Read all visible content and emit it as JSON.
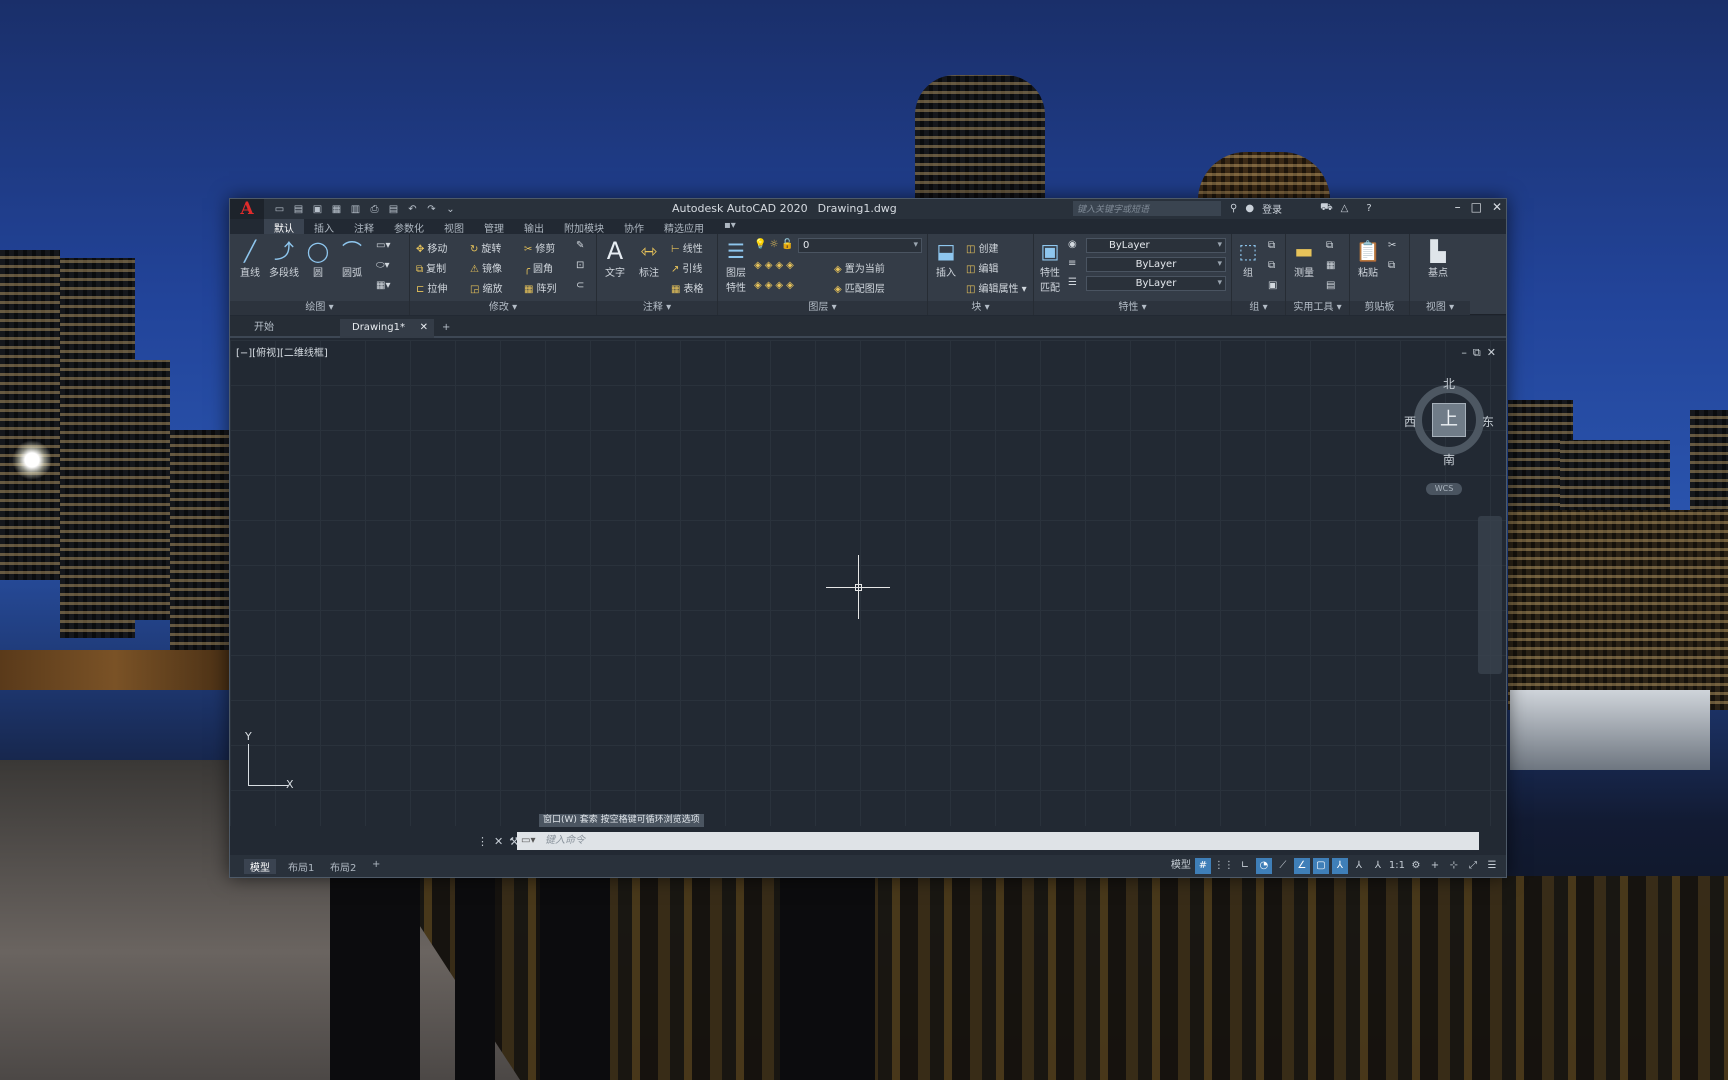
{
  "app": {
    "title": "Autodesk AutoCAD 2020",
    "filename": "Drawing1.dwg",
    "logo": "A",
    "search_placeholder": "键入关键字或短语",
    "login": "登录"
  },
  "ribbon_tabs": [
    "默认",
    "插入",
    "注释",
    "参数化",
    "视图",
    "管理",
    "输出",
    "附加模块",
    "协作",
    "精选应用"
  ],
  "panels": {
    "draw": {
      "title": "绘图 ▾",
      "line": "直线",
      "polyline": "多段线",
      "circle": "圆",
      "arc": "圆弧"
    },
    "modify": {
      "title": "修改 ▾",
      "move": "移动",
      "rotate": "旋转",
      "trim": "修剪",
      "copy": "复制",
      "mirror": "镜像",
      "fillet": "圆角",
      "stretch": "拉伸",
      "scale": "缩放",
      "array": "阵列"
    },
    "annotation": {
      "title": "注释 ▾",
      "text": "文字",
      "dimension": "标注",
      "linear": "线性",
      "leader": "引线",
      "table": "表格"
    },
    "layers": {
      "title": "图层 ▾",
      "layer_props": "图层\n特性",
      "layer_value": "0",
      "make_current": "置为当前",
      "match_layer": "匹配图层"
    },
    "block": {
      "title": "块 ▾",
      "insert": "插入",
      "create": "创建",
      "edit": "编辑",
      "edit_attr": "编辑属性"
    },
    "properties": {
      "title": "特性 ▾",
      "match": "特性\n匹配",
      "color": "ByLayer",
      "linetype": "ByLayer",
      "lineweight": "ByLayer"
    },
    "groups": {
      "title": "组 ▾",
      "group": "组"
    },
    "utilities": {
      "title": "实用工具 ▾",
      "measure": "测量"
    },
    "clipboard": {
      "title": "剪贴板",
      "paste": "粘贴"
    },
    "view": {
      "title": "视图 ▾",
      "base": "基点"
    }
  },
  "doc_tabs": {
    "start": "开始",
    "drawing": "Drawing1*",
    "close": "✕",
    "add": "+"
  },
  "viewport": {
    "label": "[−][俯视][二维线框]"
  },
  "viewcube": {
    "face": "上",
    "north": "北",
    "south": "南",
    "east": "东",
    "west": "西",
    "wcs": "WCS"
  },
  "ucs": {
    "x": "X",
    "y": "Y"
  },
  "command": {
    "history": "窗口(W) 套索  按空格键可循环浏览选项",
    "placeholder": "键入命令"
  },
  "layout_tabs": [
    "模型",
    "布局1",
    "布局2"
  ],
  "status": {
    "model": "模型",
    "scale": "1:1"
  }
}
